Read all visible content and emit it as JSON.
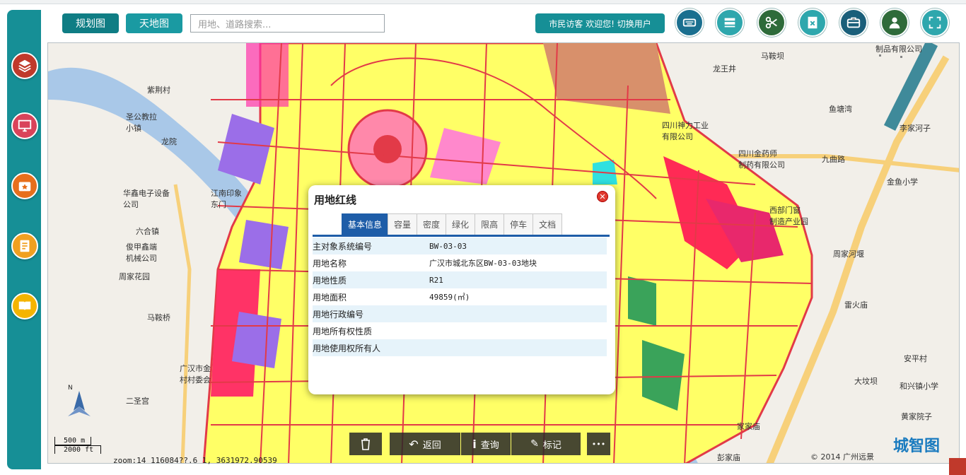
{
  "toolbar": {
    "plan_map_label": "规划图",
    "tianditu_label": "天地图",
    "search_placeholder": "用地、道路搜索...",
    "user_label": "市民访客 欢迎您! 切换用户"
  },
  "popup": {
    "title": "用地红线",
    "tabs": [
      "基本信息",
      "容量",
      "密度",
      "绿化",
      "限高",
      "停车",
      "文档"
    ],
    "active_tab": "基本信息",
    "rows": [
      {
        "key": "主对象系统编号",
        "value": "BW-03-03"
      },
      {
        "key": "用地名称",
        "value": "广汉市城北东区BW-03-03地块"
      },
      {
        "key": "用地性质",
        "value": "R21"
      },
      {
        "key": "用地面积",
        "value": "49859(㎡)"
      },
      {
        "key": "用地行政编号",
        "value": ""
      },
      {
        "key": "用地所有权性质",
        "value": ""
      },
      {
        "key": "用地使用权所有人",
        "value": ""
      }
    ]
  },
  "bottom_bar": {
    "delete": "",
    "back": "返回",
    "query": "查询",
    "mark": "标记",
    "more": "•••"
  },
  "scale": {
    "metric": "500 m",
    "imperial": "2000 ft"
  },
  "status": "zoom:14  116084??.6  1, 3631972.90539",
  "copyright": "© 2014 广州远景",
  "brand": "城智图",
  "map_labels": {
    "l1": "紫荆村",
    "l2": "圣公教拉\n小镇",
    "l3": "龙院",
    "l4": "华鑫电子设备\n公司",
    "l5": "六合镇",
    "l6": "俊甲鑫端\n机械公司",
    "l7": "周家花园",
    "l8": "马鞍桥",
    "l9": "二圣宫",
    "l10": "广汉市金\n村村委会",
    "l11": "马鞍坝",
    "l12": "龙王井",
    "l13": "鱼塘湾",
    "l14": "李家河子",
    "l15": "四川神力工业\n有限公司",
    "l16": "四川金药师\n制药有限公司",
    "l17": "金鱼小学",
    "l18": "周家河堰",
    "l19": "雷火庙",
    "l20": "安平村",
    "l21": "大坟坝",
    "l22": "和兴镇小学",
    "l23": "黄家院子",
    "l24": "彭家庙",
    "l25": "家家庙",
    "l26": "制品有限公司",
    "l27": "九曲路",
    "l28": "江南印象\n东门",
    "l29": "西部门窗\n制造产业园"
  }
}
